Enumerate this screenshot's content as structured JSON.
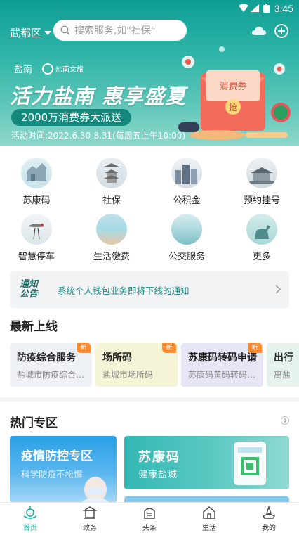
{
  "status_bar": {
    "time": "3:45"
  },
  "header": {
    "location": "武都区",
    "search_placeholder": "搜索服务,如\"社保\""
  },
  "banner": {
    "logo_left": "盐南",
    "logo_right": "盐南文旅",
    "headline": "活力盐南 惠享盛夏",
    "subtitle": "2000万消费券大派送",
    "activity_time": "活动时间:2022.6.30-8.31(每周五上午10:00)",
    "coupon_text": "消费券",
    "coupon_button": "抢"
  },
  "services": [
    {
      "label": "苏康码"
    },
    {
      "label": "社保"
    },
    {
      "label": "公积金"
    },
    {
      "label": "预约挂号"
    },
    {
      "label": "智慧停车"
    },
    {
      "label": "生活缴费"
    },
    {
      "label": "公交服务"
    },
    {
      "label": "更多"
    }
  ],
  "notice": {
    "tag_line1": "通知",
    "tag_line2": "公告",
    "text": "系统个人钱包业务即将下线的通知"
  },
  "latest": {
    "title": "最新上线",
    "badge": "新",
    "cards": [
      {
        "title": "防疫综合服务",
        "subtitle": "盐城市防疫综合…",
        "bg": "#eef1f6"
      },
      {
        "title": "场所码",
        "subtitle": "盐城市场所码",
        "bg": "#f6f4d6"
      },
      {
        "title": "苏康码转码申请",
        "subtitle": "苏康码黄码转码…",
        "bg": "#e7e6f6"
      },
      {
        "title": "出行",
        "subtitle": "离盐",
        "bg": "#e6f3ec"
      }
    ]
  },
  "hot": {
    "title": "热门专区",
    "card1": {
      "title": "疫情防控专区",
      "subtitle": "科学防疫不松懈"
    },
    "card2": {
      "title": "苏康码",
      "subtitle": "健康盐城"
    }
  },
  "tabbar": [
    {
      "label": "首页"
    },
    {
      "label": "政务"
    },
    {
      "label": "头条"
    },
    {
      "label": "生活"
    },
    {
      "label": "我的"
    }
  ],
  "colors": {
    "accent": "#1aa89b",
    "badge": "#ff8a2b"
  }
}
